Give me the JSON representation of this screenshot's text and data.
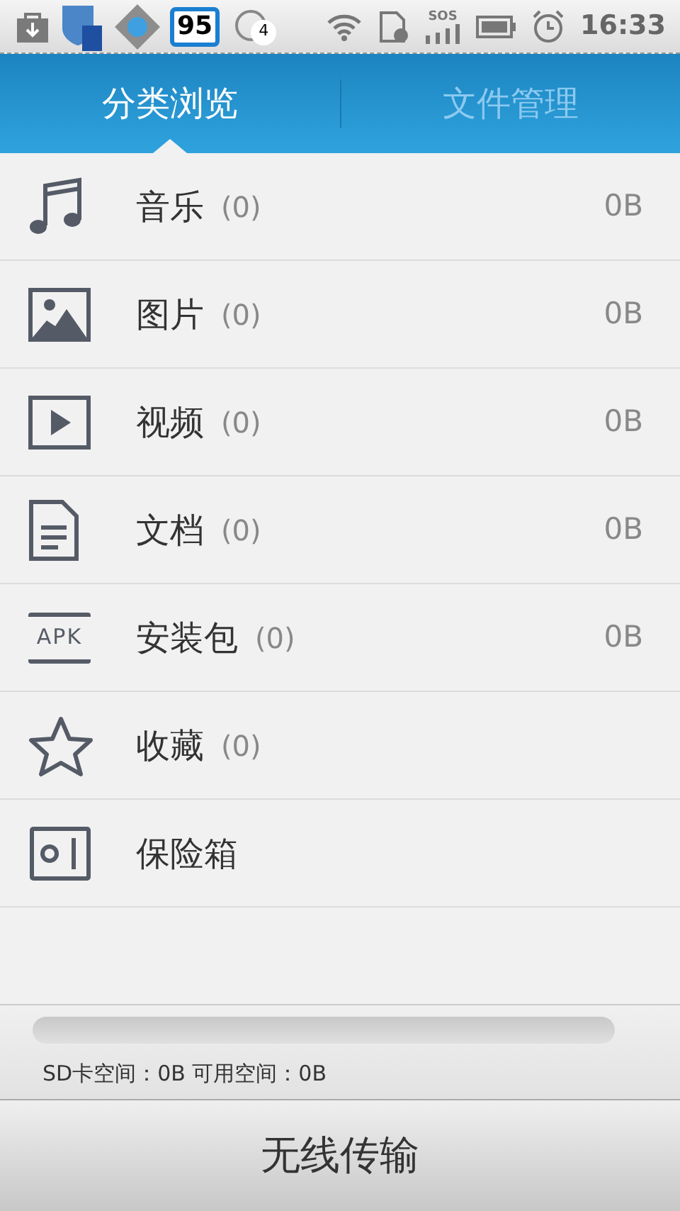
{
  "status_bar": {
    "score_badge": "95",
    "chat_count": "4",
    "signal_label": "SOS",
    "time": "16:33"
  },
  "tabs": [
    {
      "label": "分类浏览",
      "selected": true
    },
    {
      "label": "文件管理",
      "selected": false
    }
  ],
  "categories": [
    {
      "kind": "music",
      "name": "音乐",
      "count": "(0)",
      "size": "0B"
    },
    {
      "kind": "image",
      "name": "图片",
      "count": "(0)",
      "size": "0B"
    },
    {
      "kind": "video",
      "name": "视频",
      "count": "(0)",
      "size": "0B"
    },
    {
      "kind": "document",
      "name": "文档",
      "count": "(0)",
      "size": "0B"
    },
    {
      "kind": "apk",
      "icon_label": "APK",
      "name": "安装包",
      "count": "(0)",
      "size": "0B"
    },
    {
      "kind": "favorite",
      "name": "收藏",
      "count": "(0)"
    },
    {
      "kind": "safe",
      "name": "保险箱"
    }
  ],
  "storage": {
    "summary": "SD卡空间：0B 可用空间：0B"
  },
  "bottom_button": "无线传输"
}
